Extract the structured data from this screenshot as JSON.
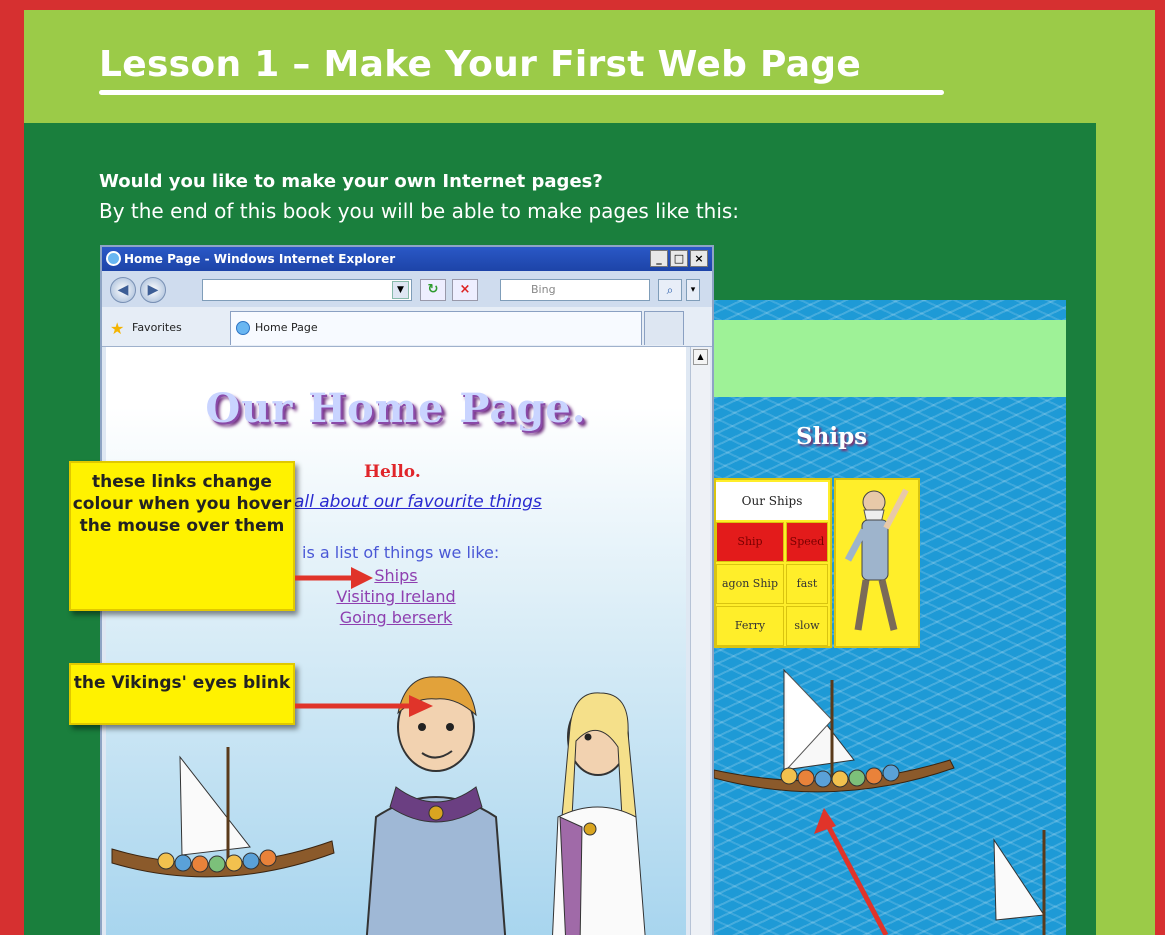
{
  "lesson": {
    "title": "Lesson 1 – Make Your First Web Page",
    "question": "Would you like to make your own Internet pages?",
    "intro": "By the end of this book you will be able to make pages like this:"
  },
  "browser": {
    "window_title": "Home Page - Windows Internet Explorer",
    "search_placeholder": "Bing",
    "favorites_label": "Favorites",
    "tab_label": "Home Page",
    "page": {
      "heading": "Our Home Page.",
      "greeting": "Hello.",
      "about_link": "all about our favourite things",
      "list_intro": "is a list of things we like:",
      "links": [
        "Ships",
        "Visiting Ireland",
        "Going berserk"
      ]
    }
  },
  "ships_page": {
    "heading": "Ships",
    "table": {
      "header": "Our Ships",
      "columns": [
        "Ship",
        "Speed"
      ],
      "rows": [
        [
          "agon Ship",
          "fast"
        ],
        [
          "Ferry",
          "slow"
        ]
      ]
    }
  },
  "callouts": {
    "links": "these links change colour when you hover the mouse over them",
    "eyes": "the Vikings' eyes blink"
  },
  "colors": {
    "border_red": "#d63030",
    "page_green": "#9bcb48",
    "panel_green": "#1a7f3d",
    "callout_yellow": "#fff200",
    "arrow_red": "#e0342a",
    "sea_blue": "#1e9ad6"
  },
  "icons": [
    "ie-icon",
    "back-icon",
    "forward-icon",
    "refresh-icon",
    "stop-icon",
    "search-icon",
    "favorites-star-icon",
    "minimize-icon",
    "maximize-icon",
    "close-icon"
  ]
}
